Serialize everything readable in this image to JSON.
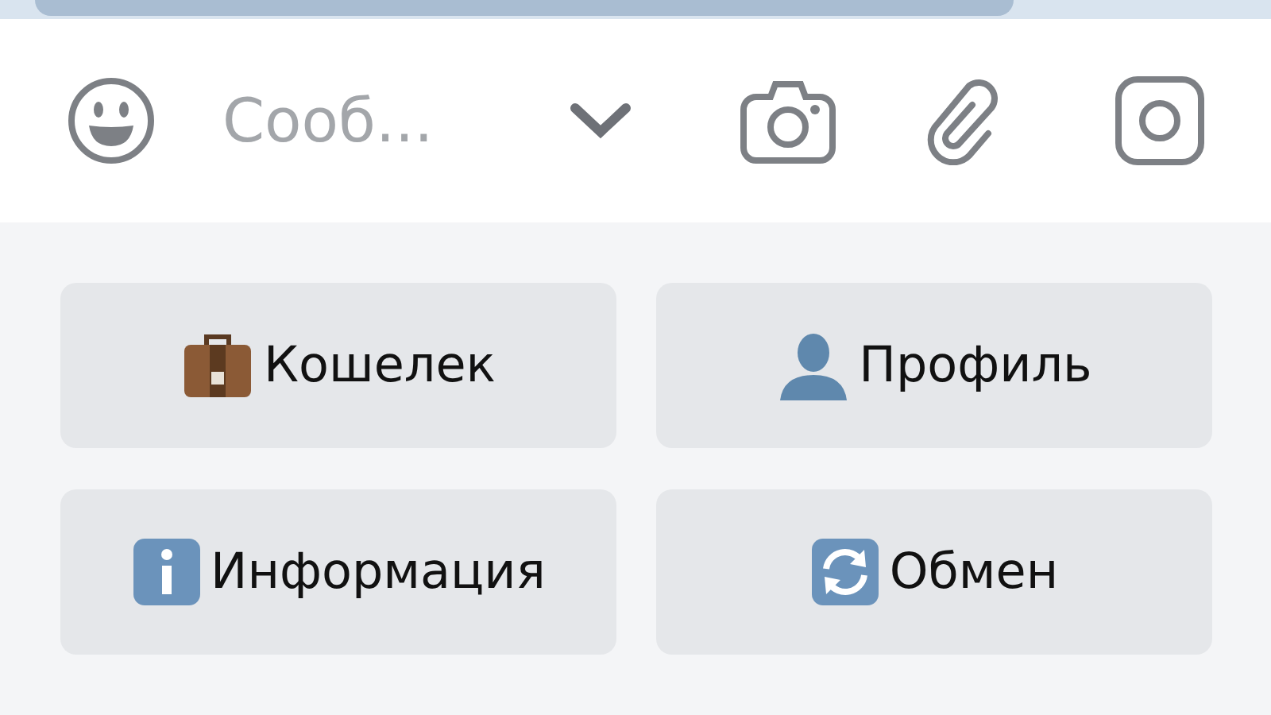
{
  "composer": {
    "placeholder": "Сооб..."
  },
  "keyboard_buttons": [
    {
      "label": "Кошелек",
      "kind": "briefcase"
    },
    {
      "label": "Профиль",
      "kind": "person"
    },
    {
      "label": "Информация",
      "kind": "info"
    },
    {
      "label": "Обмен",
      "kind": "exchange"
    }
  ]
}
